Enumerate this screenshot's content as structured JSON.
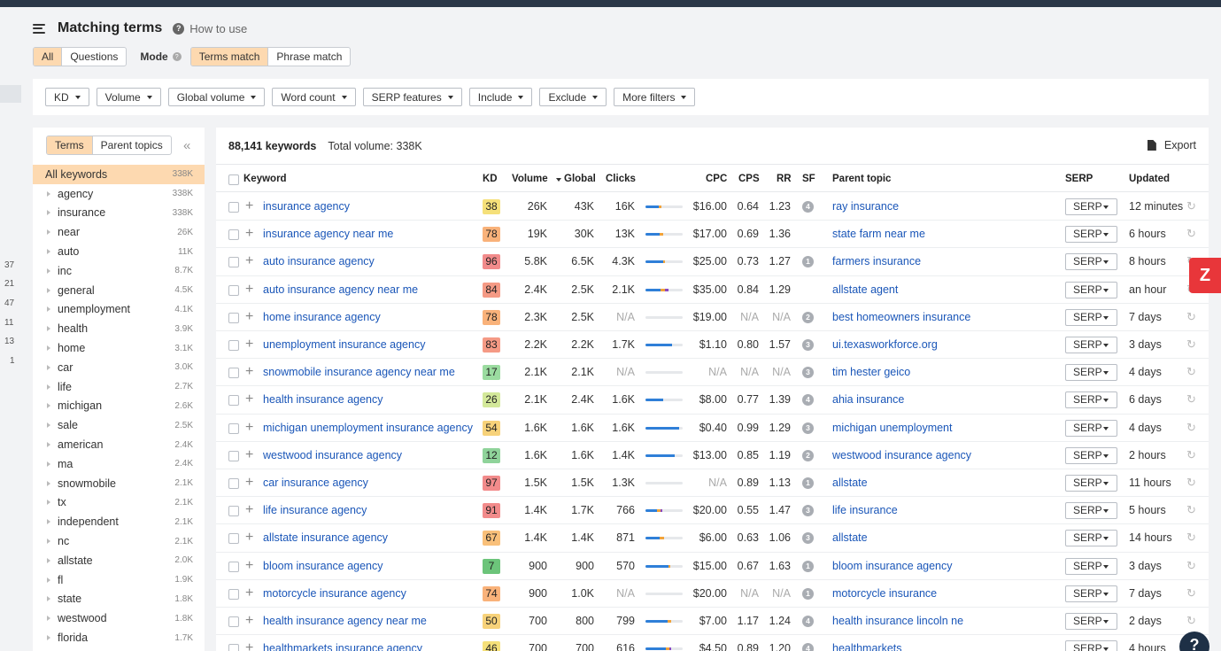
{
  "header": {
    "title": "Matching terms",
    "how_to_use": "How to use"
  },
  "mode_row": {
    "all": "All",
    "questions": "Questions",
    "mode_label": "Mode",
    "terms_match": "Terms match",
    "phrase_match": "Phrase match"
  },
  "filters": [
    "KD",
    "Volume",
    "Global volume",
    "Word count",
    "SERP features",
    "Include",
    "Exclude",
    "More filters"
  ],
  "left_strip_numbers": [
    "37",
    "21",
    "47",
    "11",
    "13",
    "1"
  ],
  "sidebar": {
    "tab_terms": "Terms",
    "tab_parent": "Parent topics",
    "collapse": "«",
    "all_label": "All keywords",
    "all_count": "338K",
    "items": [
      {
        "label": "agency",
        "count": "338K"
      },
      {
        "label": "insurance",
        "count": "338K"
      },
      {
        "label": "near",
        "count": "26K"
      },
      {
        "label": "auto",
        "count": "11K"
      },
      {
        "label": "inc",
        "count": "8.7K"
      },
      {
        "label": "general",
        "count": "4.5K"
      },
      {
        "label": "unemployment",
        "count": "4.1K"
      },
      {
        "label": "health",
        "count": "3.9K"
      },
      {
        "label": "home",
        "count": "3.1K"
      },
      {
        "label": "car",
        "count": "3.0K"
      },
      {
        "label": "life",
        "count": "2.7K"
      },
      {
        "label": "michigan",
        "count": "2.6K"
      },
      {
        "label": "sale",
        "count": "2.5K"
      },
      {
        "label": "american",
        "count": "2.4K"
      },
      {
        "label": "ma",
        "count": "2.4K"
      },
      {
        "label": "snowmobile",
        "count": "2.1K"
      },
      {
        "label": "tx",
        "count": "2.1K"
      },
      {
        "label": "independent",
        "count": "2.1K"
      },
      {
        "label": "nc",
        "count": "2.1K"
      },
      {
        "label": "allstate",
        "count": "2.0K"
      },
      {
        "label": "fl",
        "count": "1.9K"
      },
      {
        "label": "state",
        "count": "1.8K"
      },
      {
        "label": "westwood",
        "count": "1.8K"
      },
      {
        "label": "florida",
        "count": "1.7K"
      }
    ]
  },
  "table": {
    "keyword_count": "88,141 keywords",
    "total_volume": "Total volume: 338K",
    "export": "Export",
    "columns": {
      "keyword": "Keyword",
      "kd": "KD",
      "volume": "Volume",
      "global": "Global",
      "clicks": "Clicks",
      "cpc": "CPC",
      "cps": "CPS",
      "rr": "RR",
      "sf": "SF",
      "parent": "Parent topic",
      "serp": "SERP",
      "updated": "Updated"
    },
    "serp_label": "SERP",
    "rows": [
      {
        "keyword": "insurance agency",
        "kd": "38",
        "kd_color": "#f5e07a",
        "volume": "26K",
        "global": "43K",
        "clicks": "16K",
        "bar": [
          0.35,
          0.08,
          0.0
        ],
        "cpc": "$16.00",
        "cps": "0.64",
        "rr": "1.23",
        "sf": "4",
        "parent": "ray insurance",
        "updated": "12 minutes"
      },
      {
        "keyword": "insurance agency near me",
        "kd": "78",
        "kd_color": "#f9b27a",
        "volume": "19K",
        "global": "30K",
        "clicks": "13K",
        "bar": [
          0.38,
          0.1,
          0.0
        ],
        "cpc": "$17.00",
        "cps": "0.69",
        "rr": "1.36",
        "sf": "",
        "parent": "state farm near me",
        "updated": "6 hours"
      },
      {
        "keyword": "auto insurance agency",
        "kd": "96",
        "kd_color": "#f28b8b",
        "volume": "5.8K",
        "global": "6.5K",
        "clicks": "4.3K",
        "bar": [
          0.48,
          0.05,
          0.0
        ],
        "cpc": "$25.00",
        "cps": "0.73",
        "rr": "1.27",
        "sf": "1",
        "parent": "farmers insurance",
        "updated": "8 hours"
      },
      {
        "keyword": "auto insurance agency near me",
        "kd": "84",
        "kd_color": "#f59a85",
        "volume": "2.4K",
        "global": "2.5K",
        "clicks": "2.1K",
        "bar": [
          0.4,
          0.12,
          0.1
        ],
        "cpc": "$35.00",
        "cps": "0.84",
        "rr": "1.29",
        "sf": "",
        "parent": "allstate agent",
        "updated": "an hour"
      },
      {
        "keyword": "home insurance agency",
        "kd": "78",
        "kd_color": "#f9b27a",
        "volume": "2.3K",
        "global": "2.5K",
        "clicks": "N/A",
        "bar": [
          0.0,
          0.0,
          0.0
        ],
        "cpc": "$19.00",
        "cps": "N/A",
        "rr": "N/A",
        "sf": "2",
        "parent": "best homeowners insurance",
        "updated": "7 days"
      },
      {
        "keyword": "unemployment insurance agency",
        "kd": "83",
        "kd_color": "#f59a85",
        "volume": "2.2K",
        "global": "2.2K",
        "clicks": "1.7K",
        "bar": [
          0.72,
          0.0,
          0.0
        ],
        "cpc": "$1.10",
        "cps": "0.80",
        "rr": "1.57",
        "sf": "3",
        "parent": "ui.texasworkforce.org",
        "updated": "3 days"
      },
      {
        "keyword": "snowmobile insurance agency near me",
        "kd": "17",
        "kd_color": "#9bdca0",
        "volume": "2.1K",
        "global": "2.1K",
        "clicks": "N/A",
        "bar": [
          0.0,
          0.0,
          0.0
        ],
        "cpc": "N/A",
        "cps": "N/A",
        "rr": "N/A",
        "sf": "3",
        "parent": "tim hester geico",
        "updated": "4 days"
      },
      {
        "keyword": "health insurance agency",
        "kd": "26",
        "kd_color": "#d3e89a",
        "volume": "2.1K",
        "global": "2.4K",
        "clicks": "1.6K",
        "bar": [
          0.48,
          0.0,
          0.0
        ],
        "cpc": "$8.00",
        "cps": "0.77",
        "rr": "1.39",
        "sf": "4",
        "parent": "ahia insurance",
        "updated": "6 days"
      },
      {
        "keyword": "michigan unemployment insurance agency",
        "kd": "54",
        "kd_color": "#f7d27a",
        "volume": "1.6K",
        "global": "1.6K",
        "clicks": "1.6K",
        "bar": [
          0.9,
          0.0,
          0.0
        ],
        "cpc": "$0.40",
        "cps": "0.99",
        "rr": "1.29",
        "sf": "3",
        "parent": "michigan unemployment",
        "updated": "4 days"
      },
      {
        "keyword": "westwood insurance agency",
        "kd": "12",
        "kd_color": "#8fd39a",
        "volume": "1.6K",
        "global": "1.6K",
        "clicks": "1.4K",
        "bar": [
          0.78,
          0.0,
          0.0
        ],
        "cpc": "$13.00",
        "cps": "0.85",
        "rr": "1.19",
        "sf": "2",
        "parent": "westwood insurance agency",
        "updated": "2 hours"
      },
      {
        "keyword": "car insurance agency",
        "kd": "97",
        "kd_color": "#f28b8b",
        "volume": "1.5K",
        "global": "1.5K",
        "clicks": "1.3K",
        "bar": [
          0.0,
          0.0,
          0.0
        ],
        "cpc": "N/A",
        "cps": "0.89",
        "rr": "1.13",
        "sf": "1",
        "parent": "allstate",
        "updated": "11 hours"
      },
      {
        "keyword": "life insurance agency",
        "kd": "91",
        "kd_color": "#f28b8b",
        "volume": "1.4K",
        "global": "1.7K",
        "clicks": "766",
        "bar": [
          0.3,
          0.1,
          0.05
        ],
        "cpc": "$20.00",
        "cps": "0.55",
        "rr": "1.47",
        "sf": "3",
        "parent": "life insurance",
        "updated": "5 hours"
      },
      {
        "keyword": "allstate insurance agency",
        "kd": "67",
        "kd_color": "#f9c07a",
        "volume": "1.4K",
        "global": "1.4K",
        "clicks": "871",
        "bar": [
          0.38,
          0.12,
          0.0
        ],
        "cpc": "$6.00",
        "cps": "0.63",
        "rr": "1.06",
        "sf": "3",
        "parent": "allstate",
        "updated": "14 hours"
      },
      {
        "keyword": "bloom insurance agency",
        "kd": "7",
        "kd_color": "#6cc47a",
        "volume": "900",
        "global": "900",
        "clicks": "570",
        "bar": [
          0.62,
          0.05,
          0.0
        ],
        "cpc": "$15.00",
        "cps": "0.67",
        "rr": "1.63",
        "sf": "1",
        "parent": "bloom insurance agency",
        "updated": "3 days"
      },
      {
        "keyword": "motorcycle insurance agency",
        "kd": "74",
        "kd_color": "#f9b27a",
        "volume": "900",
        "global": "1.0K",
        "clicks": "N/A",
        "bar": [
          0.0,
          0.0,
          0.0
        ],
        "cpc": "$20.00",
        "cps": "N/A",
        "rr": "N/A",
        "sf": "1",
        "parent": "motorcycle insurance",
        "updated": "7 days"
      },
      {
        "keyword": "health insurance agency near me",
        "kd": "50",
        "kd_color": "#f7d27a",
        "volume": "700",
        "global": "800",
        "clicks": "799",
        "bar": [
          0.6,
          0.1,
          0.0
        ],
        "cpc": "$7.00",
        "cps": "1.17",
        "rr": "1.24",
        "sf": "4",
        "parent": "health insurance lincoln ne",
        "updated": "2 days"
      },
      {
        "keyword": "healthmarkets insurance agency",
        "kd": "46",
        "kd_color": "#f5e07a",
        "volume": "700",
        "global": "700",
        "clicks": "616",
        "bar": [
          0.55,
          0.1,
          0.05
        ],
        "cpc": "$4.50",
        "cps": "0.89",
        "rr": "1.20",
        "sf": "4",
        "parent": "healthmarkets",
        "updated": "4 hours"
      }
    ]
  },
  "colors": {
    "accent": "#fdd9b0",
    "link": "#1a56b8",
    "bar_blue": "#2f7fd8",
    "bar_orange": "#f1a33a",
    "bar_purple": "#8b4ac0"
  },
  "icons": {
    "menu": "hamburger-icon",
    "help": "question-circle-icon",
    "export": "file-download-icon",
    "refresh": "refresh-icon",
    "zapier": "zapier-icon"
  },
  "floating": {
    "zapier_glyph": "Z",
    "help_glyph": "?"
  }
}
